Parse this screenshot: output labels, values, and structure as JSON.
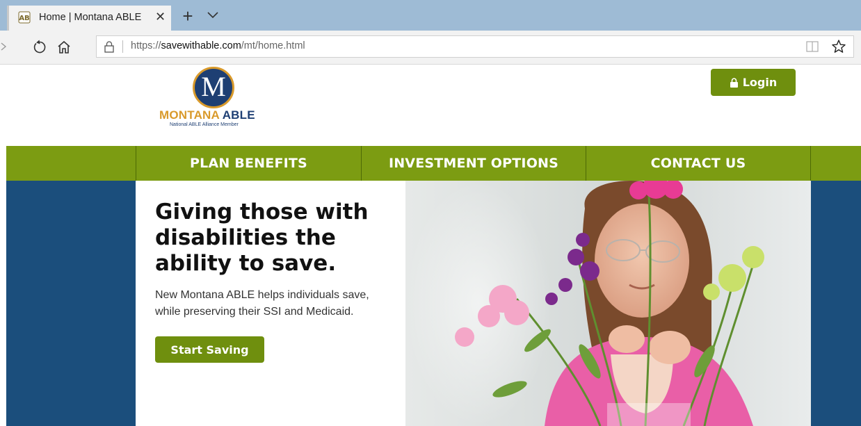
{
  "browser": {
    "tab_title": "Home | Montana ABLE",
    "tab_close": "✕",
    "new_tab": "+",
    "url_prefix": "https://",
    "url_domain": "savewithable.com",
    "url_path": "/mt/home.html"
  },
  "header": {
    "logo_letter": "M",
    "logo_name_part1": "MONTANA",
    "logo_name_part2": "ABLE",
    "logo_tagline": "National ABLE Alliance Member",
    "login_label": "Login"
  },
  "nav": {
    "items": [
      {
        "label": "PLAN BENEFITS"
      },
      {
        "label": "INVESTMENT OPTIONS"
      },
      {
        "label": "CONTACT US"
      }
    ]
  },
  "hero": {
    "heading": "Giving those with disabilities the ability to save.",
    "text": "New Montana ABLE helps individuals save, while preserving their SSI and Medicaid.",
    "cta_label": "Start Saving"
  },
  "colors": {
    "brand_green": "#7c9c12",
    "brand_navy": "#1b4e7c",
    "logo_gold": "#d99a2b",
    "browser_tabbar": "#9ebbd5"
  },
  "icons": [
    "able-favicon-icon",
    "close-icon",
    "plus-icon",
    "chevron-down-icon",
    "back-icon",
    "refresh-icon",
    "home-icon",
    "lock-icon",
    "reading-view-icon",
    "star-icon",
    "padlock-icon"
  ]
}
